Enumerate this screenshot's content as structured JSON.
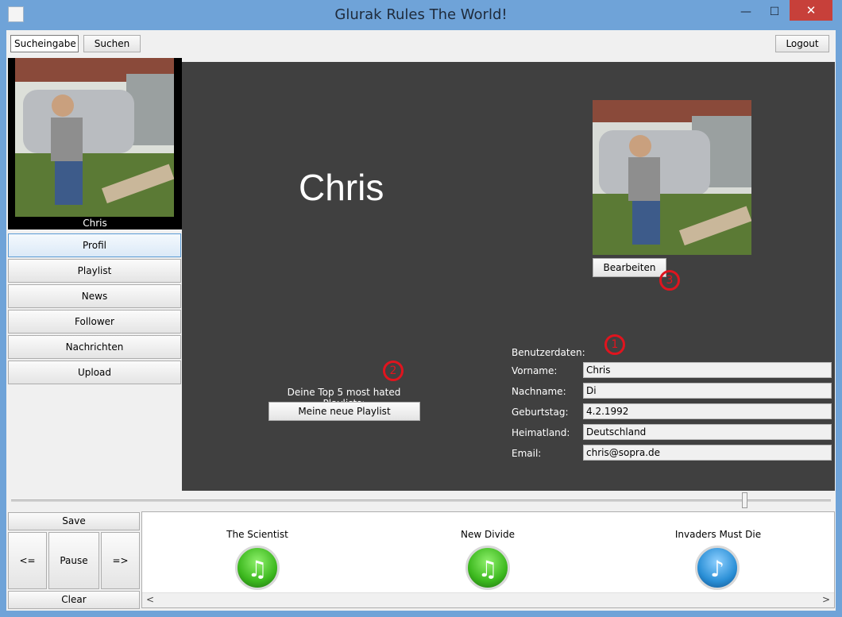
{
  "window": {
    "title": "Glurak Rules The World!",
    "close_glyph": "✕",
    "maximize_glyph": "☐",
    "minimize_glyph": "—"
  },
  "toolbar": {
    "search_value": "Sucheingabe",
    "search_button": "Suchen",
    "logout_button": "Logout"
  },
  "sidebar": {
    "user_name": "Chris",
    "items": [
      {
        "label": "Profil"
      },
      {
        "label": "Playlist"
      },
      {
        "label": "News"
      },
      {
        "label": "Follower"
      },
      {
        "label": "Nachrichten"
      },
      {
        "label": "Upload"
      }
    ]
  },
  "profile": {
    "name": "Chris",
    "edit_button": "Bearbeiten",
    "top_playlists_label": "Deine Top 5 most hated Playlists:",
    "playlist_button": "Meine neue Playlist",
    "userdata_header": "Benutzerdaten:",
    "fields": [
      {
        "label": "Vorname:",
        "value": "Chris"
      },
      {
        "label": "Nachname:",
        "value": "Di"
      },
      {
        "label": "Geburtstag:",
        "value": "4.2.1992"
      },
      {
        "label": "Heimatland:",
        "value": "Deutschland"
      },
      {
        "label": "Email:",
        "value": "chris@sopra.de"
      }
    ],
    "markers": [
      "1",
      "2",
      "3"
    ]
  },
  "player": {
    "save": "Save",
    "prev": "<=",
    "pause": "Pause",
    "next": "=>",
    "clear": "Clear",
    "scroll_left": "<",
    "scroll_right": ">",
    "tracks": [
      {
        "title": "The Scientist",
        "icon": "music-note-icon",
        "color": "#3cb81e"
      },
      {
        "title": "New Divide",
        "icon": "music-note-icon",
        "color": "#3cb81e"
      },
      {
        "title": "Invaders Must Die",
        "icon": "music-note-icon",
        "color": "#2a8fd6"
      }
    ]
  },
  "colors": {
    "panel": "#404040",
    "titlebar": "#6fa3d8",
    "marker": "#e0141e",
    "close": "#c7403a"
  }
}
